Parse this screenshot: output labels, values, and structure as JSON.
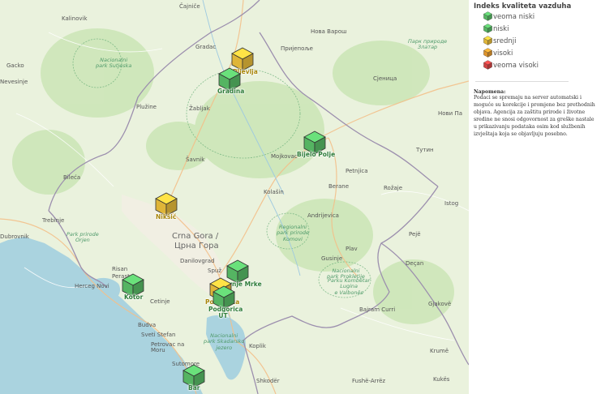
{
  "legend": {
    "title": "Indeks kvaliteta vazduha",
    "items": [
      {
        "label": "veoma niski",
        "color": "#5cc46b"
      },
      {
        "label": "niski",
        "color": "#5cc46b"
      },
      {
        "label": "srednji",
        "color": "#f2c53d"
      },
      {
        "label": "visoki",
        "color": "#f0a030"
      },
      {
        "label": "veoma visoki",
        "color": "#e04848"
      }
    ]
  },
  "note": {
    "title": "Napomena:",
    "body": "Podaci se spremaju na server automatski i moguće su korekcije i promjene bez prethodnih objava. Agencija za zaštitu prirode i životne sredine ne snosi odgovornost za greške nastale u prikazivanju podataka osim kod službenih izvještaja koja se objavljuju posebno."
  },
  "stations": [
    {
      "name": "Pljevlja",
      "level": "srednji",
      "color": "#f2c53d",
      "label_color": "yellow"
    },
    {
      "name": "Gradina",
      "level": "niski",
      "color": "#5cc46b",
      "label_color": "green"
    },
    {
      "name": "Bijelo Polje",
      "level": "niski",
      "color": "#5cc46b",
      "label_color": "green"
    },
    {
      "name": "Nikšić",
      "level": "srednji",
      "color": "#f2c53d",
      "label_color": "yellow"
    },
    {
      "name": "Kotor",
      "level": "niski",
      "color": "#5cc46b",
      "label_color": "green"
    },
    {
      "name": "Gornje Mrke",
      "level": "niski",
      "color": "#5cc46b",
      "label_color": "green"
    },
    {
      "name": "Podgorica",
      "level": "srednji",
      "color": "#f2c53d",
      "label_color": "yellow"
    },
    {
      "name": "Podgorica UT",
      "level": "niski",
      "color": "#5cc46b",
      "label_color": "green"
    },
    {
      "name": "Bar",
      "level": "niski",
      "color": "#5cc46b",
      "label_color": "green"
    }
  ],
  "map_labels": {
    "cajnice": "Čajniče",
    "kalinovik": "Kalinovik",
    "gacko": "Gacko",
    "nevesinje": "Nevesinje",
    "bileca": "Bileća",
    "trebinje": "Trebinje",
    "dubrovnik": "Dubrovnik",
    "herceg_novi": "Herceg Novi",
    "risan": "Risan",
    "perast": "Perast",
    "cetinje": "Cetinje",
    "budva": "Budva",
    "sveti_stefan": "Sveti Stefan",
    "petrovac": "Petrovac na Moru",
    "sutomore": "Sutomore",
    "pluzine": "Plužine",
    "zabljak": "Žabljak",
    "savnik": "Šavnik",
    "gradac": "Gradac",
    "kolasin": "Kolašin",
    "mojkovac": "Mojkovac",
    "berane": "Berane",
    "andrijevica": "Andrijevica",
    "plav": "Plav",
    "gusinje": "Gusinje",
    "petnjica": "Petnjica",
    "rozaje": "Rožaje",
    "danilovgrad": "Danilovgrad",
    "spuz": "Spuž",
    "prijepolje": "Пријепоље",
    "nova_varos": "Нова Варош",
    "sjenica": "Сјеница",
    "novi_pazar": "Нови Па",
    "tutin": "Тутин",
    "istog": "Istog",
    "peje": "Pejë",
    "decan": "Deçan",
    "gjakove": "Gjakovë",
    "bajram_curri": "Bajram Curri",
    "krume": "Krumë",
    "kukes": "Kukës",
    "fushe_arrez": "Fushë-Arrëz",
    "shkoder": "Shkodër",
    "koplik": "Koplik",
    "country": "Crna Gora /",
    "country_cyr": "Црна Гора"
  },
  "parks": {
    "sutjeska": "Nacionalni\npark Sutjeska",
    "orjen": "Park prirode\nOrjen",
    "komovi": "Regionalni\npark prirode\nKomovi",
    "prokletije": "Nacionalni\npark Prokletije",
    "zlatar": "Парк природе\nЗлатар",
    "skadar": "Nacionalni\npark Skadarsko\njezero",
    "thethi": "Parku Kombëtar\nLugina\ne Valbonës"
  }
}
